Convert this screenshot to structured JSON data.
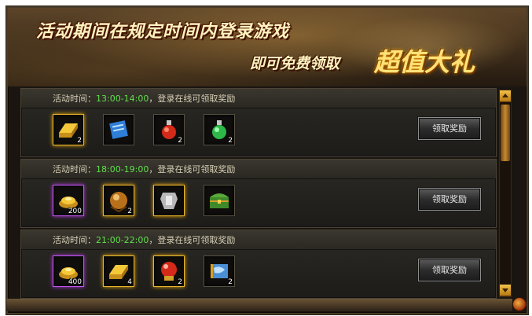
{
  "banner": {
    "line1": "活动期间在规定时间内登录游戏",
    "line2": "即可免费领取",
    "big": "超值大礼"
  },
  "rows": [
    {
      "label": "活动时间：",
      "time": "13:00-14:00",
      "suffix": "，登录在线可领取奖励",
      "button": "领取奖励",
      "items": [
        {
          "icon": "gold-bar-icon",
          "quality": "gold",
          "count": "2"
        },
        {
          "icon": "blue-scroll-icon",
          "quality": "none",
          "count": ""
        },
        {
          "icon": "red-potion-icon",
          "quality": "none",
          "count": "2"
        },
        {
          "icon": "green-potion-icon",
          "quality": "none",
          "count": "2"
        }
      ]
    },
    {
      "label": "活动时间：",
      "time": "18:00-19:00",
      "suffix": "，登录在线可领取奖励",
      "button": "领取奖励",
      "items": [
        {
          "icon": "gold-ingot-icon",
          "quality": "purple",
          "count": "200"
        },
        {
          "icon": "bronze-orb-icon",
          "quality": "gold",
          "count": "2"
        },
        {
          "icon": "silver-armor-icon",
          "quality": "gold",
          "count": ""
        },
        {
          "icon": "treasure-chest-icon",
          "quality": "none",
          "count": ""
        }
      ]
    },
    {
      "label": "活动时间：",
      "time": "21:00-22:00",
      "suffix": "，登录在线可领取奖励",
      "button": "领取奖励",
      "items": [
        {
          "icon": "gold-ingot-icon",
          "quality": "purple",
          "count": "400"
        },
        {
          "icon": "gold-bar-icon",
          "quality": "gold",
          "count": "4"
        },
        {
          "icon": "red-orb-icon",
          "quality": "gold",
          "count": "2"
        },
        {
          "icon": "blue-map-icon",
          "quality": "none",
          "count": "2"
        }
      ]
    }
  ],
  "colors": {
    "time_green": "#5fe04a",
    "gold_quality": "#e9b530",
    "purple_quality": "#c155f0"
  }
}
